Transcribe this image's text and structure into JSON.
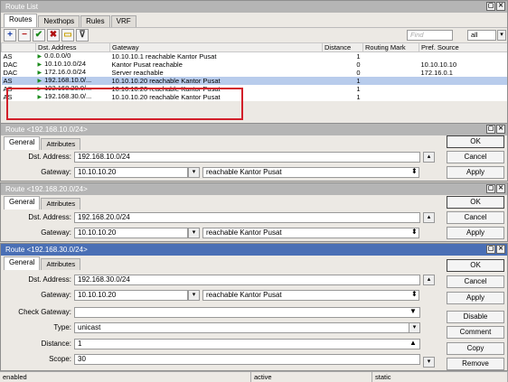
{
  "route_list": {
    "title": "Route List",
    "tabs": [
      "Routes",
      "Nexthops",
      "Rules",
      "VRF"
    ],
    "find_placeholder": "Find",
    "filter_value": "all",
    "columns": [
      "",
      "Dst. Address",
      "Gateway",
      "Distance",
      "Routing Mark",
      "Pref. Source"
    ],
    "rows": [
      {
        "flags": "AS",
        "dst": "0.0.0.0/0",
        "gateway": "10.10.10.1 reachable Kantor Pusat",
        "distance": "1",
        "mark": "",
        "pref": "",
        "selected": false
      },
      {
        "flags": "DAC",
        "dst": "10.10.10.0/24",
        "gateway": "Kantor Pusat reachable",
        "distance": "0",
        "mark": "",
        "pref": "10.10.10.10",
        "selected": false
      },
      {
        "flags": "DAC",
        "dst": "172.16.0.0/24",
        "gateway": "Server reachable",
        "distance": "0",
        "mark": "",
        "pref": "172.16.0.1",
        "selected": false
      },
      {
        "flags": "AS",
        "dst": "192.168.10.0/...",
        "gateway": "10.10.10.20 reachable Kantor Pusat",
        "distance": "1",
        "mark": "",
        "pref": "",
        "selected": true
      },
      {
        "flags": "AS",
        "dst": "192.168.20.0/...",
        "gateway": "10.10.10.20 reachable Kantor Pusat",
        "distance": "1",
        "mark": "",
        "pref": "",
        "selected": false
      },
      {
        "flags": "AS",
        "dst": "192.168.30.0/...",
        "gateway": "10.10.10.20 reachable Kantor Pusat",
        "distance": "1",
        "mark": "",
        "pref": "",
        "selected": false
      }
    ]
  },
  "route1": {
    "title": "Route <192.168.10.0/24>",
    "tabs": [
      "General",
      "Attributes"
    ],
    "dst_label": "Dst. Address:",
    "dst_value": "192.168.10.0/24",
    "gw_label": "Gateway:",
    "gw_value": "10.10.10.20",
    "gw_status": "reachable Kantor Pusat",
    "buttons": [
      "OK",
      "Cancel",
      "Apply"
    ]
  },
  "route2": {
    "title": "Route <192.168.20.0/24>",
    "tabs": [
      "General",
      "Attributes"
    ],
    "dst_label": "Dst. Address:",
    "dst_value": "192.168.20.0/24",
    "gw_label": "Gateway:",
    "gw_value": "10.10.10.20",
    "gw_status": "reachable Kantor Pusat",
    "buttons": [
      "OK",
      "Cancel",
      "Apply"
    ]
  },
  "route3": {
    "title": "Route <192.168.30.0/24>",
    "tabs": [
      "General",
      "Attributes"
    ],
    "dst_label": "Dst. Address:",
    "dst_value": "192.168.30.0/24",
    "gw_label": "Gateway:",
    "gw_value": "10.10.10.20",
    "gw_status": "reachable Kantor Pusat",
    "check_label": "Check Gateway:",
    "check_value": "",
    "type_label": "Type:",
    "type_value": "unicast",
    "distance_label": "Distance:",
    "distance_value": "1",
    "scope_label": "Scope:",
    "scope_value": "30",
    "buttons": [
      "OK",
      "Cancel",
      "Apply",
      "Disable",
      "Comment",
      "Copy",
      "Remove"
    ]
  },
  "status": [
    "enabled",
    "active",
    "static"
  ],
  "colors": {
    "active_title": "#4a6fb5",
    "inactive_title": "#b5b5b5",
    "selection": "#b8ccec",
    "highlight": "#d21f2a"
  }
}
